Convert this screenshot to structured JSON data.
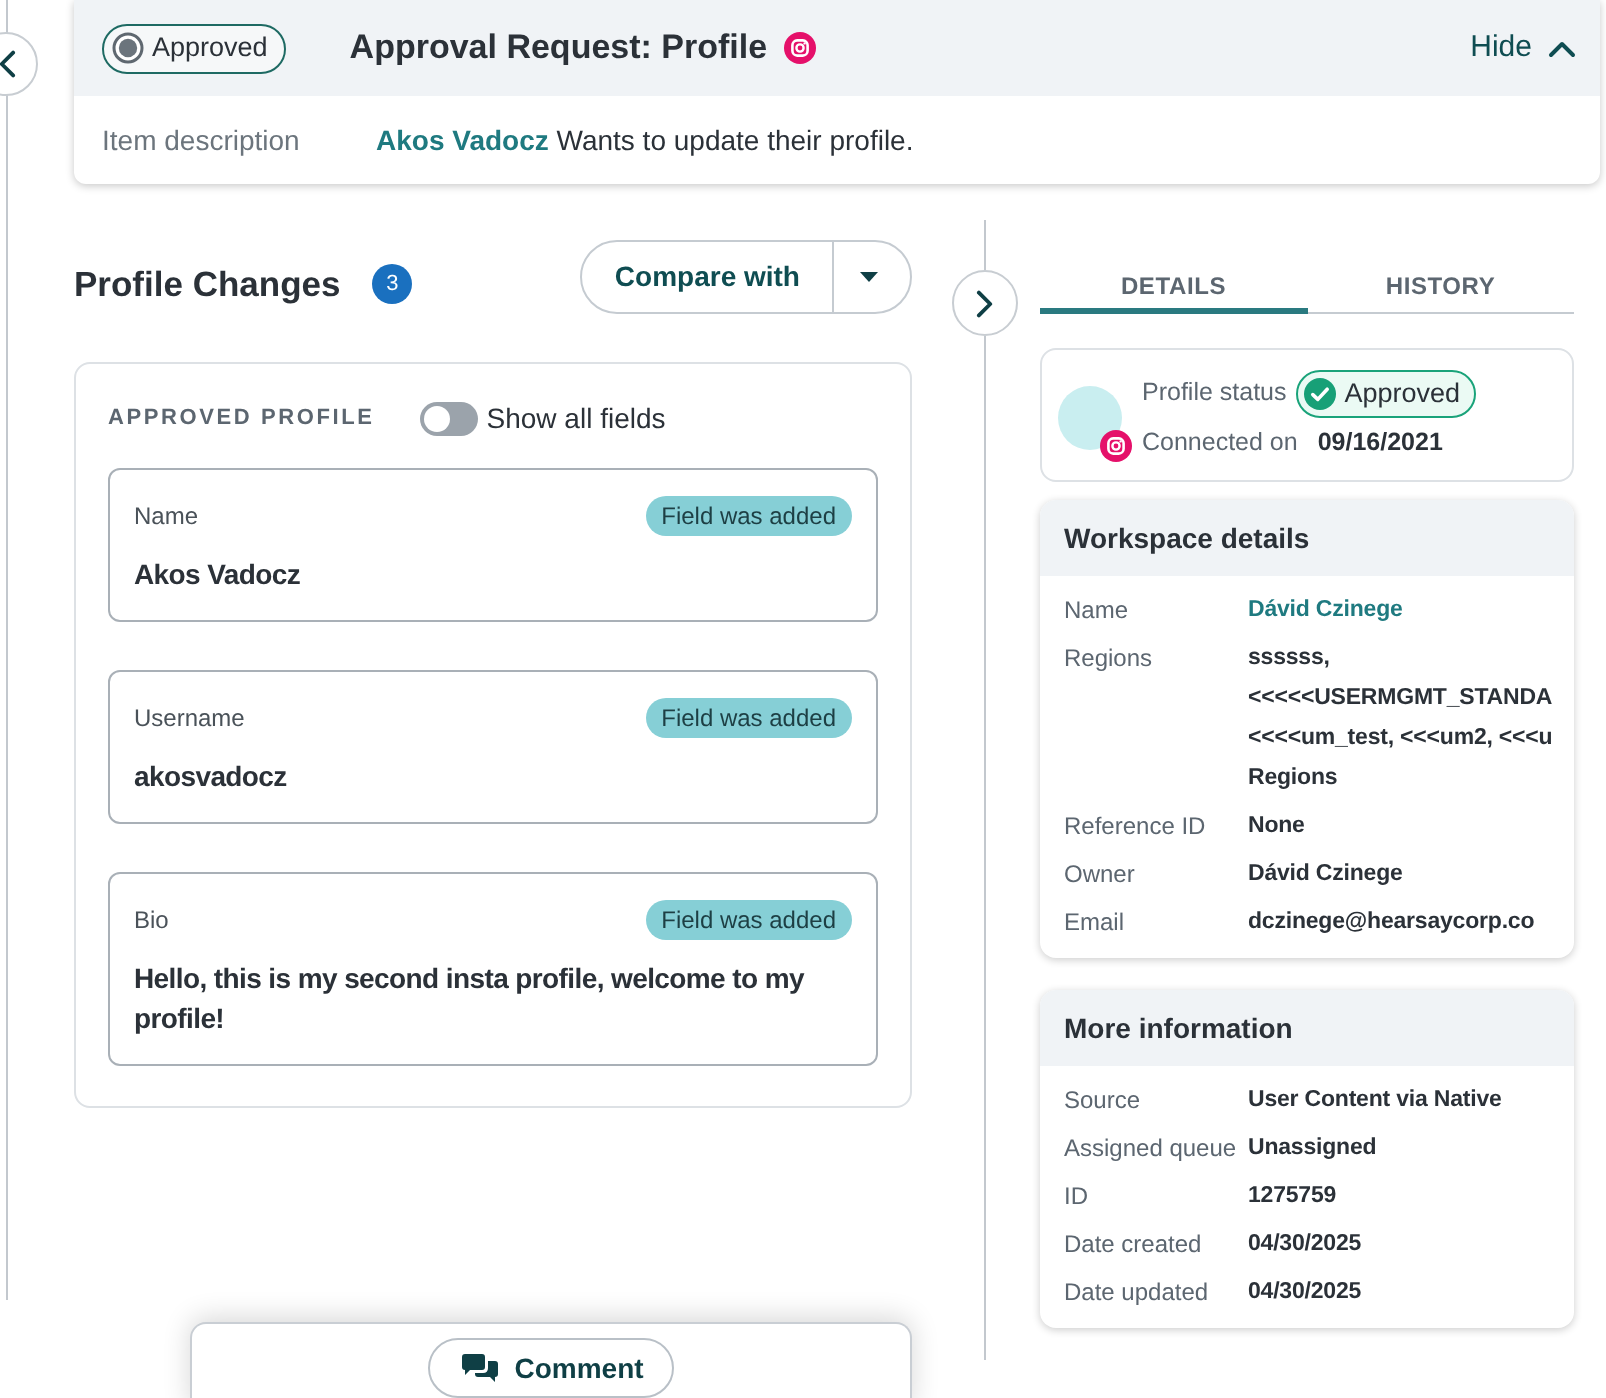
{
  "top_card": {
    "status": "Approved",
    "title": "Approval Request: Profile",
    "hide_button": "Hide",
    "description_label": "Item description",
    "description": {
      "author": "Akos Vadocz",
      "text": "Wants to update their profile."
    }
  },
  "profile_changes": {
    "title": "Profile Changes",
    "count": "3",
    "compare_button": "Compare with",
    "section_label": "APPROVED PROFILE",
    "show_all_fields": {
      "label": "Show all fields",
      "on": false
    },
    "fields": [
      {
        "label": "Name",
        "tag": "Field was added",
        "value": "Akos Vadocz"
      },
      {
        "label": "Username",
        "tag": "Field was added",
        "value": "akosvadocz"
      },
      {
        "label": "Bio",
        "tag": "Field was added",
        "value": "Hello, this is my second insta profile, welcome to my profile!"
      }
    ]
  },
  "details_panel": {
    "tabs": [
      {
        "label": "DETAILS",
        "selected": true
      },
      {
        "label": "HISTORY",
        "selected": false
      }
    ],
    "profile": {
      "status_label": "Profile status",
      "status": "Approved",
      "connected_label": "Connected on",
      "connected_date": "09/16/2021"
    },
    "sections": [
      {
        "title": "Workspace details",
        "rows": [
          {
            "label": "Name",
            "kind": "link",
            "value": "Dávid Czinege"
          },
          {
            "label": "Regions",
            "kind": "lines",
            "lines": [
              "ssssss,",
              "<<<<<USERMGMT_STANDA",
              "<<<<um_test, <<<um2, <<<u",
              "Regions"
            ]
          },
          {
            "label": "Reference ID",
            "kind": "text",
            "value": "None"
          },
          {
            "label": "Owner",
            "kind": "text",
            "value": "Dávid Czinege"
          },
          {
            "label": "Email",
            "kind": "text",
            "value": "dczinege@hearsaycorp.co"
          }
        ]
      },
      {
        "title": "More information",
        "rows": [
          {
            "label": "Source",
            "kind": "text",
            "value": "User Content via Native"
          },
          {
            "label": "Assigned queue",
            "kind": "text",
            "value": "Unassigned"
          },
          {
            "label": "ID",
            "kind": "text",
            "value": "1275759"
          },
          {
            "label": "Date created",
            "kind": "text",
            "value": "04/30/2025"
          },
          {
            "label": "Date updated",
            "kind": "text",
            "value": "04/30/2025"
          }
        ]
      }
    ]
  },
  "footer": {
    "comment_button": "Comment"
  }
}
